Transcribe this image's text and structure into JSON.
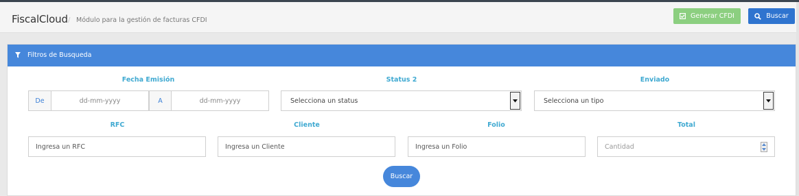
{
  "header": {
    "app_title": "FiscalCloud",
    "separator": "/",
    "subtitle": "Módulo para la gestión de facturas CFDI",
    "generate_button": "Generar CFDI",
    "search_button": "Buscar"
  },
  "panel": {
    "title": "Filtros de Busqueda"
  },
  "filters": {
    "fecha_emision": {
      "label": "Fecha Emisión",
      "from_addon": "De",
      "from_placeholder": "dd-mm-yyyy",
      "to_addon": "A",
      "to_placeholder": "dd-mm-yyyy"
    },
    "status": {
      "label": "Status 2",
      "selected": "Selecciona un status"
    },
    "enviado": {
      "label": "Enviado",
      "selected": "Selecciona un tipo"
    },
    "rfc": {
      "label": "RFC",
      "value": "Ingresa un RFC"
    },
    "cliente": {
      "label": "Cliente",
      "value": "Ingresa un Cliente"
    },
    "folio": {
      "label": "Folio",
      "value": "Ingresa un Folio"
    },
    "total": {
      "label": "Total",
      "placeholder": "Cantidad"
    }
  },
  "actions": {
    "search_button": "Buscar"
  },
  "colors": {
    "primary": "#4687db",
    "success": "#8ccf80",
    "label": "#3fa9d1"
  },
  "icons": {
    "generate": "check-square-icon",
    "search": "search-icon",
    "filter": "filter-icon"
  }
}
